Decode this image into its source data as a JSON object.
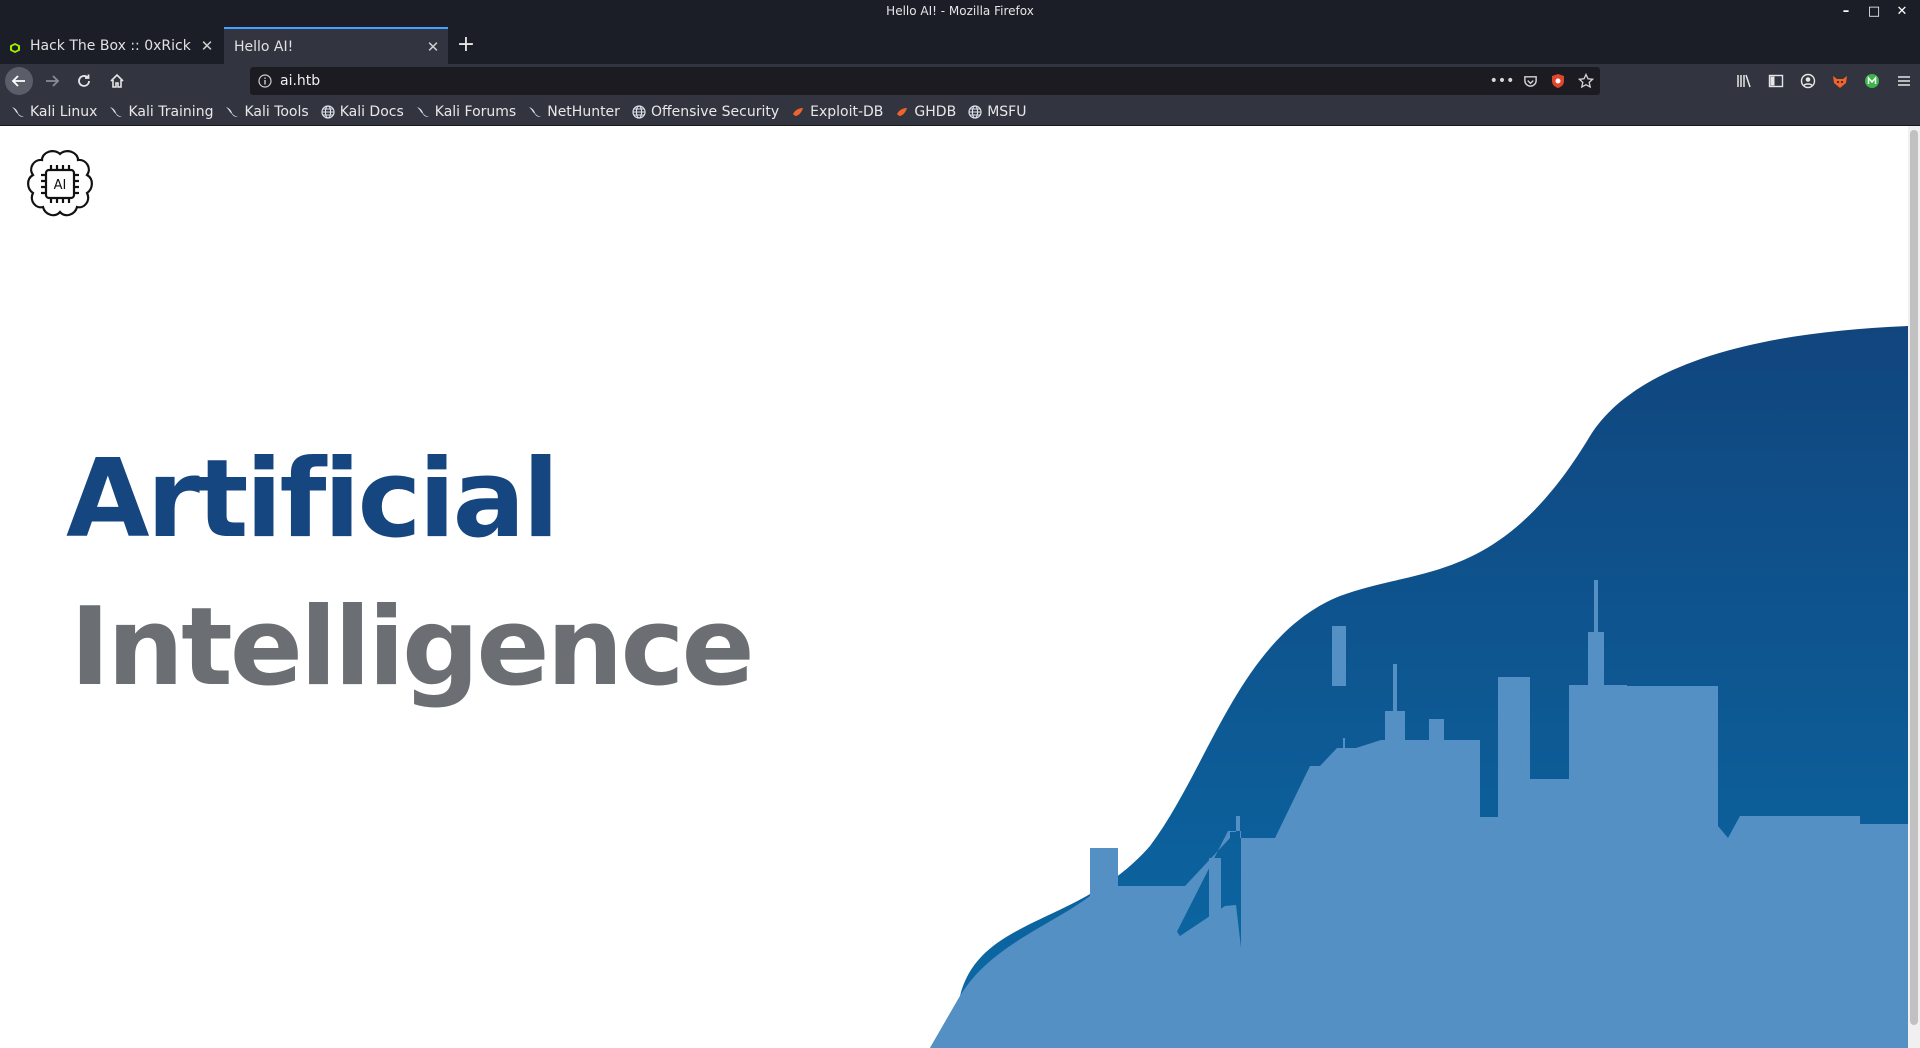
{
  "window": {
    "title": "Hello AI! - Mozilla Firefox",
    "controls": {
      "minimize": "–",
      "maximize": "□",
      "close": "✕"
    }
  },
  "tabs": [
    {
      "label": "Hack The Box :: 0xRick",
      "close": "✕",
      "active": false
    },
    {
      "label": "Hello AI!",
      "close": "✕",
      "active": true
    }
  ],
  "new_tab": "+",
  "urlbar": {
    "url": "ai.htb",
    "more": "•••"
  },
  "bookmarks": [
    {
      "label": "Kali Linux",
      "icon": "kali-dragon-icon"
    },
    {
      "label": "Kali Training",
      "icon": "kali-dragon-icon"
    },
    {
      "label": "Kali Tools",
      "icon": "kali-dragon-icon"
    },
    {
      "label": "Kali Docs",
      "icon": "globe-icon"
    },
    {
      "label": "Kali Forums",
      "icon": "kali-dragon-icon"
    },
    {
      "label": "NetHunter",
      "icon": "kali-dragon-icon"
    },
    {
      "label": "Offensive Security",
      "icon": "globe-icon"
    },
    {
      "label": "Exploit-DB",
      "icon": "exploit-db-icon"
    },
    {
      "label": "GHDB",
      "icon": "exploit-db-icon"
    },
    {
      "label": "MSFU",
      "icon": "globe-icon"
    }
  ],
  "page": {
    "logo_text": "AI",
    "headline_1": "Artificial",
    "headline_2": "Intelligence"
  },
  "colors": {
    "headline_primary": "#16467f",
    "headline_secondary": "#6b6f73",
    "wave_top": "#11457e",
    "wave_bottom": "#0a6aa6",
    "skyline": "#5590c4"
  }
}
